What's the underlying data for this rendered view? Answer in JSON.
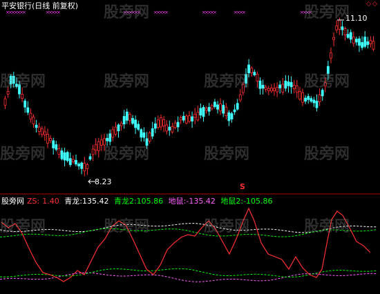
{
  "title": "平安银行(日线 前复权)",
  "high_label": "11.10",
  "low_label": "8.23",
  "signal_mark": "S",
  "top_right_icons": "◇◇",
  "watermark": "股旁网",
  "legend": {
    "source": "股旁网",
    "zs_label": "ZS:",
    "zs_value": "1.40",
    "qinglong_label": "青龙:",
    "qinglong_value": "135.42",
    "qinglong2_label": "青龙2:",
    "qinglong2_value": "105.86",
    "dishu_label": "地鼠:",
    "dishu_value": "-135.42",
    "dishu2_label": "地鼠2:",
    "dishu2_value": "-105.86"
  },
  "colors": {
    "background": "#000000",
    "up_candle": "#ff3030",
    "down_candle": "#40ffff",
    "zs_line": "#ff3030",
    "qinglong": "#ffffff",
    "qinglong2": "#00ff00",
    "dishu": "#ff60ff",
    "dishu2": "#00ff00",
    "markers": "#ff40ff"
  }
}
